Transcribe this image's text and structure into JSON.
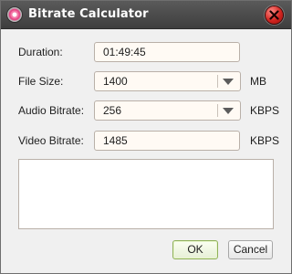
{
  "window": {
    "title": "Bitrate Calculator",
    "app_icon": "disc-icon",
    "close_icon": "close-icon"
  },
  "form": {
    "duration": {
      "label": "Duration:",
      "value": "01:49:45"
    },
    "file_size": {
      "label": "File Size:",
      "value": "1400",
      "unit": "MB"
    },
    "audio_bitrate": {
      "label": "Audio Bitrate:",
      "value": "256",
      "unit": "KBPS"
    },
    "video_bitrate": {
      "label": "Video Bitrate:",
      "value": "1485",
      "unit": "KBPS"
    }
  },
  "output": {
    "value": ""
  },
  "buttons": {
    "ok_label": "OK",
    "cancel_label": "Cancel"
  },
  "colors": {
    "titlebar": "#4a4a4a",
    "close_button": "#d1241f",
    "ok_border": "#8fb05a"
  }
}
